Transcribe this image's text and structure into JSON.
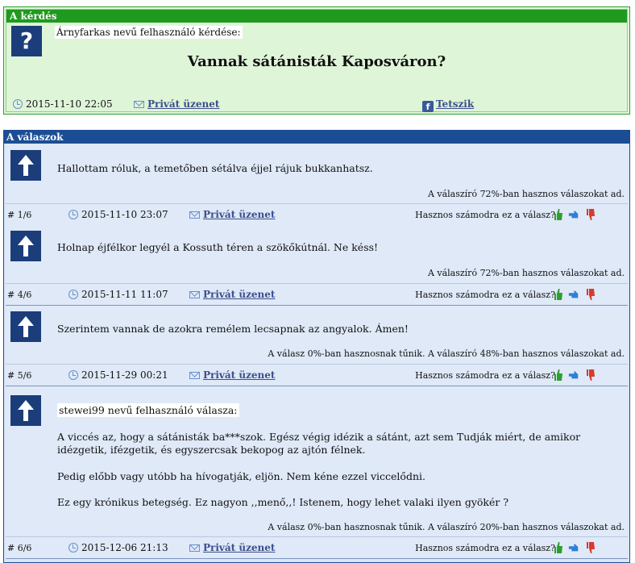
{
  "question": {
    "header": "A kérdés",
    "user_line": "Árnyfarkas nevű felhasználó kérdése:",
    "title": "Vannak sátánisták Kaposváron?",
    "date": "2015-11-10 22:05",
    "private_message": "Privát üzenet",
    "like": "Tetszik"
  },
  "answers_header": "A válaszok",
  "useful_prompt": "Hasznos számodra ez a válasz?",
  "private_message": "Privát üzenet",
  "answers": [
    {
      "text": "Hallottam róluk, a temetőben sétálva éjjel rájuk bukkanhatsz.",
      "stat": "A válaszíró 72%-ban hasznos válaszokat ad.",
      "num": "# 1/6",
      "date": "2015-11-10 23:07"
    },
    {
      "text": "Holnap éjfélkor legyél a Kossuth téren a szökőkútnál. Ne késs!",
      "stat": "A válaszíró 72%-ban hasznos válaszokat ad.",
      "num": "# 4/6",
      "date": "2015-11-11 11:07"
    },
    {
      "text": "Szerintem vannak de azokra remélem lecsapnak az angyalok. Ámen!",
      "stat": "A válasz 0%-ban hasznosnak tűnik. A válaszíró 48%-ban hasznos válaszokat ad.",
      "num": "# 5/6",
      "date": "2015-11-29 00:21"
    },
    {
      "user_line": "stewei99 nevű felhasználó válasza:",
      "paragraphs": [
        "A viccés az, hogy a sátánisták ba***szok. Egész végig idézik a sátánt, azt sem Tudják miért, de amikor idézgetik, ifézgetik, és egyszercsak bekopog az ajtón félnek.",
        "Pedig előbb vagy utóbb ha hívogatják, eljön. Nem kéne ezzel viccelődni.",
        "Ez egy krónikus betegség. Ez nagyon ,,menő,,! Istenem, hogy lehet valaki ilyen gyökér ?"
      ],
      "stat": "A válasz 0%-ban hasznosnak tűnik. A válaszíró 20%-ban hasznos válaszokat ad.",
      "num": "# 6/6",
      "date": "2015-12-06 21:13"
    }
  ],
  "colors": {
    "question_green": "#1f9a1f",
    "answers_blue": "#1b4d94",
    "thumb_up": "#2ca02c",
    "thumb_neutral": "#2e7fd6",
    "thumb_down": "#d63b2e"
  }
}
